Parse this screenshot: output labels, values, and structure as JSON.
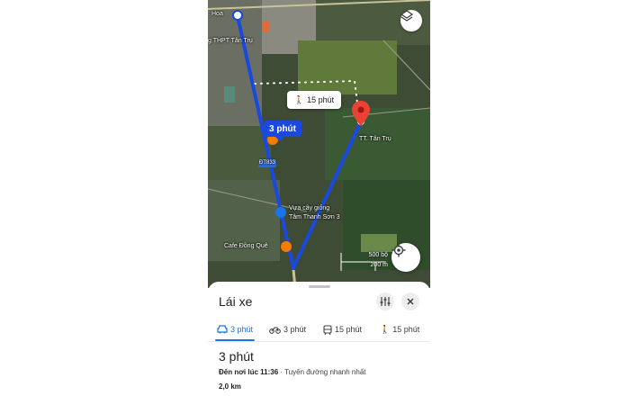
{
  "map": {
    "labels": {
      "hoa": "Hoa",
      "school": "g THPT Tân Trụ",
      "road": "ĐT833",
      "town": "TT. Tân Trụ",
      "nursery_line1": "Vựa cây giống",
      "nursery_line2": "Tâm Thanh Sơn 3",
      "cafe": "Cafe Đồng Quê"
    },
    "walk_chip": "15 phút",
    "drive_chip": "3 phút",
    "scale": {
      "imperial": "500 bộ",
      "metric": "200 m"
    },
    "icons": {
      "layers": "layers-icon",
      "locate": "my-location-icon",
      "destination": "red-pin-icon"
    },
    "colors": {
      "route": "#1a49e0",
      "pin": "#ea4335",
      "accent": "#1a73e8"
    }
  },
  "sheet": {
    "title": "Lái xe",
    "modes": [
      {
        "label": "3 phút",
        "icon": "car-icon"
      },
      {
        "label": "3 phút",
        "icon": "motorbike-icon"
      },
      {
        "label": "15 phút",
        "icon": "transit-icon"
      },
      {
        "label": "15 phút",
        "icon": "walk-icon"
      }
    ],
    "duration": "3 phút",
    "arrive_label": "Đến nơi lúc 11:36",
    "route_note": " · Tuyến đường nhanh nhất",
    "distance": "2,0 km"
  }
}
